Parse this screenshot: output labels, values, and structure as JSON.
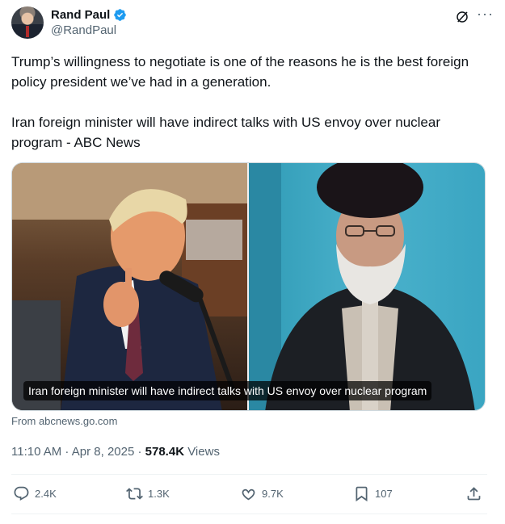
{
  "author": {
    "display_name": "Rand Paul",
    "handle": "@RandPaul",
    "verified_icon": "verified-badge-icon"
  },
  "tweet": {
    "paragraph_1": "Trump’s willingness to negotiate is one of the reasons he is the best foreign policy president we’ve had in a generation.",
    "paragraph_2": "Iran foreign minister will have indirect talks with US envoy over nuclear program - ABC News"
  },
  "card": {
    "caption": "Iran foreign minister will have indirect talks with US envoy over nuclear program",
    "source": "From abcnews.go.com"
  },
  "meta": {
    "timestamp": "11:10 AM · Apr 8, 2025 · ",
    "views_count": "578.4K",
    "views_label": " Views"
  },
  "actions": {
    "replies": "2.4K",
    "reposts": "1.3K",
    "likes": "9.7K",
    "bookmarks": "107"
  },
  "colors": {
    "text_primary": "#0f1419",
    "text_secondary": "#536471",
    "verified_blue": "#1d9bf0"
  }
}
